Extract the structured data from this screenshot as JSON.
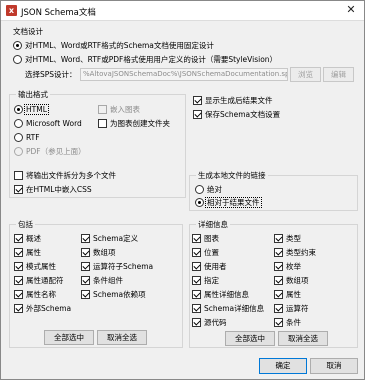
{
  "window": {
    "title": "JSON Schema文档",
    "close_glyph": "✕"
  },
  "doc_design": {
    "title": "文档设计",
    "option_fixed": "对HTML、Word或RTF格式的Schema文档使用固定设计",
    "option_custom": "对HTML、Word、RTF或PDF格式使用用户定义的设计（需要StyleVision）",
    "sps_label": "选择SPS设计：",
    "sps_value": "%AltovaJSONSchemaDoc%\\JSONSchemaDocumentation.sps",
    "browse": "浏览",
    "edit": "编辑"
  },
  "output_format": {
    "title": "输出格式",
    "html": "HTML",
    "word": "Microsoft Word",
    "rtf": "RTF",
    "pdf": "PDF（参见上面）",
    "embed_diagrams": "嵌入图表",
    "create_folder": "为图表创建文件夹",
    "split_files": "将输出文件拆分为多个文件",
    "embed_css": "在HTML中嵌入CSS"
  },
  "result_options": {
    "show_result": "显示生成后结果文件",
    "save_settings": "保存Schema文档设置"
  },
  "links": {
    "title": "生成本地文件的链接",
    "absolute": "绝对",
    "relative": "相对于结果文件"
  },
  "include": {
    "title": "包括",
    "items": [
      "概述",
      "属性",
      "模式属性",
      "属性通配符",
      "属性名称",
      "外部Schema"
    ],
    "items2": [
      "Schema定义",
      "数组项",
      "运算符子Schema",
      "条件组件",
      "Schema依赖项"
    ],
    "select_all": "全部选中",
    "deselect_all": "取消全选"
  },
  "details": {
    "title": "详细信息",
    "items": [
      "图表",
      "位置",
      "使用者",
      "指定",
      "属性详细信息",
      "Schema详细信息",
      "源代码"
    ],
    "items2": [
      "类型",
      "类型约束",
      "枚举",
      "数组项",
      "属性",
      "运算符",
      "条件"
    ],
    "select_all": "全部选中",
    "deselect_all": "取消全选"
  },
  "footer": {
    "ok": "确定",
    "cancel": "取消"
  }
}
